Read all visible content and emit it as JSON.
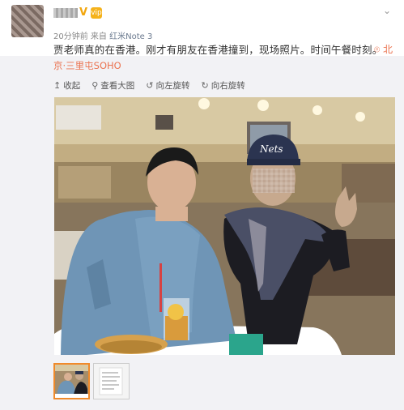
{
  "post": {
    "badge": "V",
    "vip_label": "vip",
    "time": "20分钟前",
    "source_prefix": "来自",
    "device": "红米Note 3",
    "text": "贾老师真的在香港。刚才有朋友在香港撞到，现场照片。时间午餐时刻。",
    "location_short": "北",
    "location_full": "京·三里屯SOHO"
  },
  "toolbar": {
    "collapse": "收起",
    "view_large": "查看大图",
    "rotate_left": "向左旋转",
    "rotate_right": "向右旋转"
  },
  "photo": {
    "cap_text": "Nets"
  },
  "colors": {
    "accent": "#eb7350",
    "background_gray": "#f2f2f5",
    "thumb_border": "#f08a2b"
  }
}
